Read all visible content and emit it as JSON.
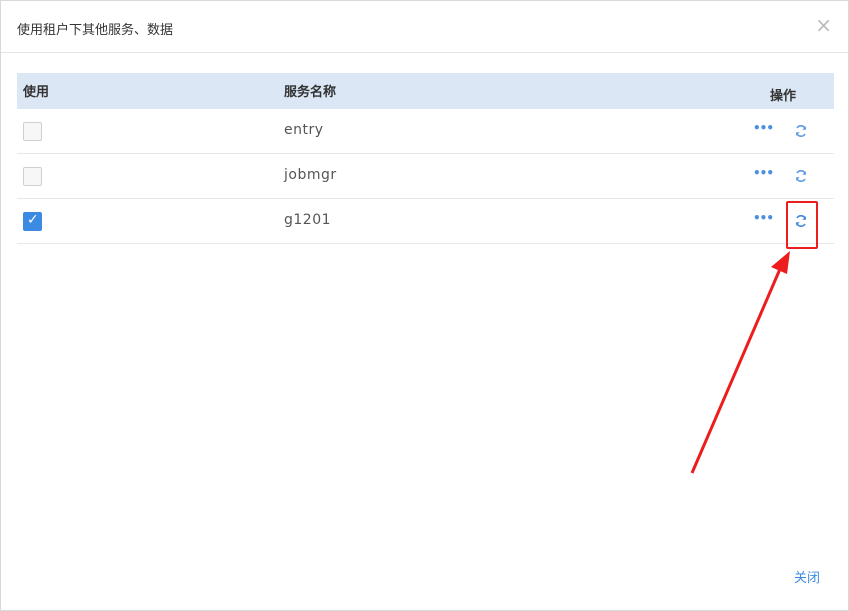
{
  "dialog": {
    "title": "使用租户下其他服务、数据",
    "close_icon": "×",
    "footer_close": "关闭"
  },
  "table": {
    "headers": {
      "use": "使用",
      "name": "服务名称",
      "ops": "操作"
    },
    "rows": [
      {
        "name": "entry",
        "checked": false
      },
      {
        "name": "jobmgr",
        "checked": false
      },
      {
        "name": "g1201",
        "checked": true
      }
    ],
    "more_glyph": "•••"
  },
  "annotation": {
    "color": "#ee1d1d"
  }
}
